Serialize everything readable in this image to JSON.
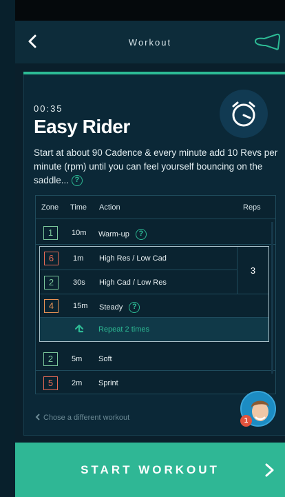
{
  "nav": {
    "title": "Workout"
  },
  "workout": {
    "timer": "00:35",
    "title": "Easy Rider",
    "description": "Start at about 90 Cadence & every minute add 10 Revs per minute (rpm) until you can feel yourself bouncing on the saddle...",
    "help_glyph": "?"
  },
  "table": {
    "headers": {
      "zone": "Zone",
      "time": "Time",
      "action": "Action",
      "reps": "Reps"
    },
    "rows": [
      {
        "zone": "1",
        "time": "10m",
        "action": "Warm-up"
      },
      {
        "zone": "6",
        "time": "1m",
        "action": "High Res / Low Cad"
      },
      {
        "zone": "2",
        "time": "30s",
        "action": "High Cad / Low Res"
      },
      {
        "zone": "4",
        "time": "15m",
        "action": "Steady"
      },
      {
        "zone": "2",
        "time": "5m",
        "action": "Soft"
      },
      {
        "zone": "5",
        "time": "2m",
        "action": "Sprint"
      }
    ],
    "group_reps": "3",
    "repeat_label": "Repeat 2 times"
  },
  "footer": {
    "choose_label": "Chose a different workout",
    "badge_count": "1",
    "start_label": "START WORKOUT"
  },
  "colors": {
    "accent": "#2dbb95",
    "zone_green": "#7bc79b",
    "zone_red": "#e76b55",
    "zone_orange": "#e99355"
  },
  "icons": [
    "back-arrow-icon",
    "saddle-icon",
    "stopwatch-icon",
    "help-icon",
    "repeat-arrow-icon",
    "chevron-left-icon",
    "chevron-right-icon"
  ]
}
